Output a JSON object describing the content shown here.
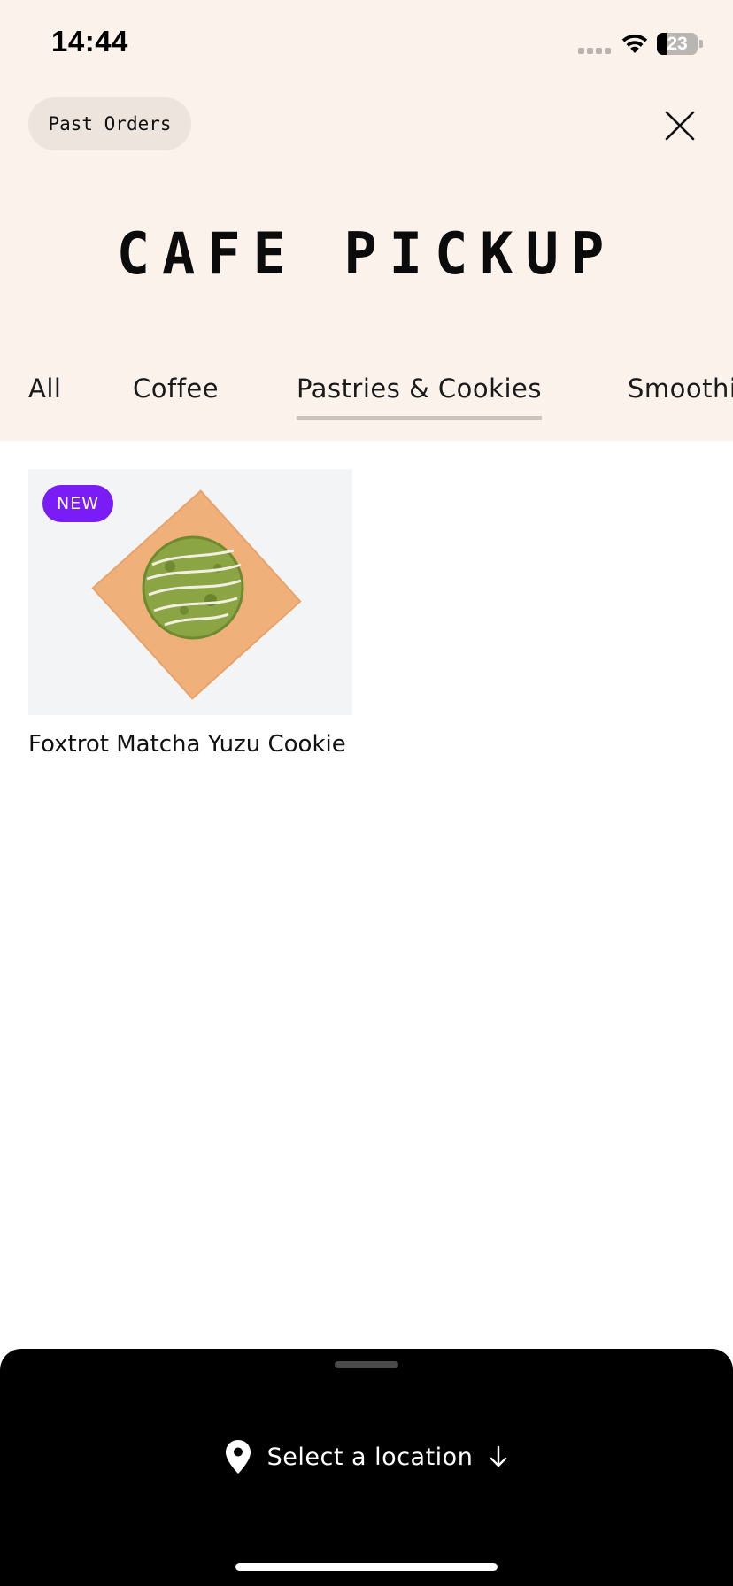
{
  "status_bar": {
    "time": "14:44",
    "battery_level": 23,
    "battery_text": "23"
  },
  "header": {
    "past_orders_label": "Past Orders",
    "brand_title": "CAFE PICKUP"
  },
  "tabs": [
    {
      "label": "All",
      "active": false
    },
    {
      "label": "Coffee",
      "active": false
    },
    {
      "label": "Pastries & Cookies",
      "active": true
    },
    {
      "label": "Smoothies",
      "active": false
    }
  ],
  "products": [
    {
      "name": "Foxtrot Matcha Yuzu Cookie",
      "badge": "NEW"
    }
  ],
  "bottom_sheet": {
    "location_label": "Select a location"
  },
  "icons": {
    "close": "close-icon",
    "location": "location-pin-icon",
    "arrow": "arrow-down-icon",
    "wifi": "wifi-icon",
    "battery": "battery-icon"
  },
  "colors": {
    "header_background": "#fbf2ec",
    "badge_background": "#7a1cf6",
    "sheet_background": "#000000",
    "pill_background": "#ede5dd"
  }
}
